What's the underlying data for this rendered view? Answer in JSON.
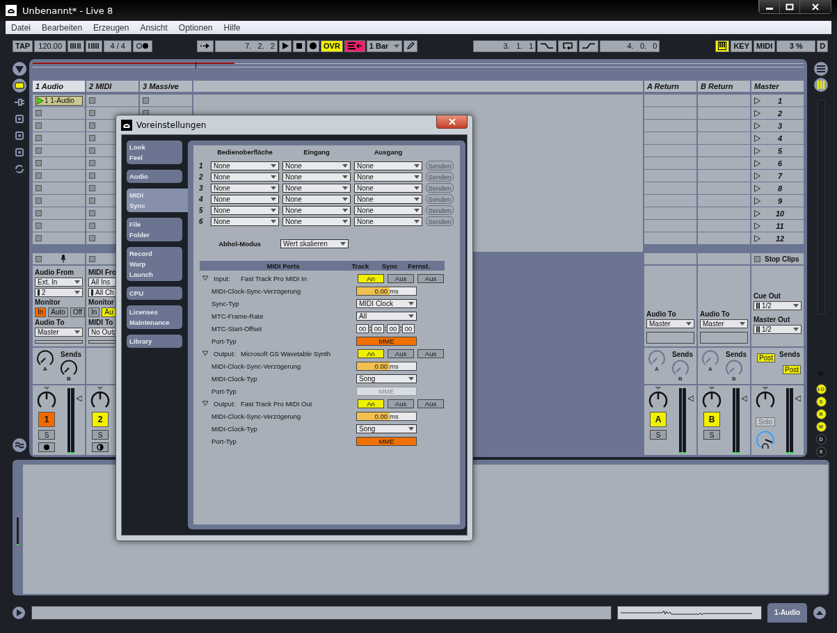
{
  "window": {
    "title": "Unbenannt* - Live 8"
  },
  "menu": [
    "Datei",
    "Bearbeiten",
    "Erzeugen",
    "Ansicht",
    "Optionen",
    "Hilfe"
  ],
  "transport": {
    "tap": "TAP",
    "tempo": "120.00",
    "signature": "4 / 4",
    "position": "7.   2.   2",
    "overdub": {
      "label": "OVR",
      "on": true
    },
    "automation_on": true,
    "quantize": "1 Bar",
    "loop_start": "3.   1.   1",
    "loop_length": "4.   0.   0",
    "key_map_on": true,
    "key": "KEY",
    "midi": "MIDI",
    "cpu": "3 %",
    "disk": "D"
  },
  "tracks": [
    {
      "name": "1 Audio",
      "kind": "audio",
      "selected": true,
      "slots": [
        {
          "has_clip": true,
          "name": "1 1-Audio",
          "playing": true
        },
        {
          "has_clip": false
        },
        {
          "has_clip": false
        },
        {
          "has_clip": false
        },
        {
          "has_clip": false
        },
        {
          "has_clip": false
        },
        {
          "has_clip": false
        },
        {
          "has_clip": false
        },
        {
          "has_clip": false
        },
        {
          "has_clip": false
        },
        {
          "has_clip": false
        },
        {
          "has_clip": false
        }
      ],
      "io": {
        "input_label": "Audio From",
        "input_type": "Ext. In",
        "input_channel": "2",
        "monitor_label": "Monitor",
        "monitor": [
          {
            "label": "In",
            "selected": true
          },
          {
            "label": "Auto",
            "selected": false
          },
          {
            "label": "Off",
            "selected": false
          }
        ],
        "output_label": "Audio To",
        "output": "Master"
      },
      "sends": {
        "label": "Sends",
        "knobs": [
          "A",
          "B"
        ]
      },
      "mixer": {
        "number": "1",
        "color": "#f06a00",
        "solo": "S"
      }
    },
    {
      "name": "2 MIDI",
      "kind": "midi",
      "selected": false,
      "slots": [
        {
          "has_clip": false
        },
        {
          "has_clip": false
        },
        {
          "has_clip": false
        },
        {
          "has_clip": false
        },
        {
          "has_clip": false
        },
        {
          "has_clip": false
        },
        {
          "has_clip": false
        },
        {
          "has_clip": false
        },
        {
          "has_clip": false
        },
        {
          "has_clip": false
        },
        {
          "has_clip": false
        },
        {
          "has_clip": false
        }
      ],
      "io": {
        "input_label": "MIDI Fro",
        "input_type": "All Ins",
        "input_channel": "All Ch",
        "monitor_label": "Monitor",
        "monitor": [
          {
            "label": "In",
            "selected": false
          },
          {
            "label": "Au",
            "selected": true
          }
        ],
        "output_label": "MIDI To",
        "output": "No Outp"
      },
      "mixer": {
        "number": "2",
        "color": "#f0f000",
        "solo": "S"
      }
    },
    {
      "name": "3 Massive",
      "selected": false,
      "slots": [
        {
          "has_clip": false
        },
        {
          "has_clip": false
        }
      ]
    }
  ],
  "returns": [
    {
      "name": "A Return",
      "io": {
        "output_label": "Audio To",
        "output": "Master"
      },
      "sends": {
        "label": "Sends",
        "knobs": [
          "A",
          "B"
        ]
      },
      "mixer": {
        "number": "A",
        "color": "#f0f000",
        "solo": "S"
      }
    },
    {
      "name": "B Return",
      "io": {
        "output_label": "Audio To",
        "output": "Master"
      },
      "sends": {
        "label": "Sends",
        "knobs": [
          "A",
          "B"
        ]
      },
      "mixer": {
        "number": "B",
        "color": "#f0f000",
        "solo": "S"
      }
    }
  ],
  "master": {
    "name": "Master",
    "scenes": [
      "1",
      "2",
      "3",
      "4",
      "5",
      "6",
      "7",
      "8",
      "9",
      "10",
      "11",
      "12"
    ],
    "stop_clips": "Stop Clips",
    "cue_out_label": "Cue Out",
    "cue_out": "1/2",
    "master_out_label": "Master Out",
    "master_out": "1/2",
    "sends_label": "Sends",
    "post": [
      "Post",
      "Post"
    ],
    "solo": "Solo"
  },
  "view_buttons": [
    {
      "label": "I-O",
      "on": true
    },
    {
      "label": "S",
      "on": true
    },
    {
      "label": "R",
      "on": true
    },
    {
      "label": "M",
      "on": true
    },
    {
      "label": "D",
      "on": false
    },
    {
      "label": "X",
      "on": false
    }
  ],
  "status_bar": {
    "track": "1-Audio"
  },
  "preferences": {
    "title": "Voreinstellungen",
    "tabs": [
      {
        "lines": [
          "Look",
          "Feel"
        ],
        "selected": false
      },
      {
        "lines": [
          "Audio"
        ],
        "selected": false
      },
      {
        "lines": [
          "MIDI",
          "Sync"
        ],
        "selected": true
      },
      {
        "lines": [
          "File",
          "Folder"
        ],
        "selected": false
      },
      {
        "lines": [
          "Record",
          "Warp",
          "Launch"
        ],
        "selected": false
      },
      {
        "lines": [
          "CPU"
        ],
        "selected": false
      },
      {
        "lines": [
          "Licenses",
          "Maintenance"
        ],
        "selected": false
      },
      {
        "lines": [
          "Library"
        ],
        "selected": false
      }
    ],
    "control_surfaces": {
      "columns": [
        "Bedienoberfläche",
        "Eingang",
        "Ausgang"
      ],
      "rows": [
        {
          "number": "1",
          "surface": "None",
          "input": "None",
          "output": "None",
          "send": "Senden",
          "disabled": true
        },
        {
          "number": "2",
          "surface": "None",
          "input": "None",
          "output": "None",
          "send": "Senden",
          "disabled": true
        },
        {
          "number": "3",
          "surface": "None",
          "input": "None",
          "output": "None",
          "send": "Senden",
          "disabled": true
        },
        {
          "number": "4",
          "surface": "None",
          "input": "None",
          "output": "None",
          "send": "Senden",
          "disabled": true
        },
        {
          "number": "5",
          "surface": "None",
          "input": "None",
          "output": "None",
          "send": "Senden",
          "disabled": true
        },
        {
          "number": "6",
          "surface": "None",
          "input": "None",
          "output": "None",
          "send": "Senden",
          "disabled": true
        }
      ]
    },
    "takeover": {
      "label": "Abhol-Modus",
      "value": "Wert skalieren"
    },
    "ports": {
      "columns": [
        "MIDI Ports",
        "Track",
        "Sync",
        "Fernst."
      ],
      "items": [
        {
          "direction": "Input:",
          "name": "Fast Track Pro MIDI In",
          "expanded": true,
          "switches": [
            {
              "label": "An",
              "on": true
            },
            {
              "label": "Aus",
              "on": false
            },
            {
              "label": "Aus",
              "on": false
            }
          ],
          "settings": [
            {
              "kind": "delay",
              "label": "MIDI-Clock-Sync-Verzögerung",
              "value": "0.00",
              "unit": "ms",
              "level": 0.55
            },
            {
              "kind": "choice",
              "label": "Sync-Typ",
              "value": "MIDI Clock"
            },
            {
              "kind": "choice",
              "label": "MTC-Frame-Rate",
              "value": "All"
            },
            {
              "kind": "timecode",
              "label": "MTC-Start-Offset",
              "fields": [
                "00",
                "00",
                "00",
                "00"
              ]
            },
            {
              "kind": "porttype",
              "label": "Port-Typ",
              "value": "MME",
              "on": true
            }
          ]
        },
        {
          "direction": "Output:",
          "name": "Microsoft GS Wavetable Synth",
          "expanded": true,
          "switches": [
            {
              "label": "An",
              "on": true
            },
            {
              "label": "Aus",
              "on": false
            },
            {
              "label": "Aus",
              "on": false
            }
          ],
          "settings": [
            {
              "kind": "delay",
              "label": "MIDI-Clock-Sync-Verzögerung",
              "value": "0.00",
              "unit": "ms",
              "level": 0.55
            },
            {
              "kind": "choice",
              "label": "MIDI-Clock-Typ",
              "value": "Song"
            },
            {
              "kind": "porttype",
              "label": "Port-Typ",
              "value": "MME",
              "on": false
            }
          ]
        },
        {
          "direction": "Output:",
          "name": "Fast Track Pro MIDI Out",
          "expanded": true,
          "switches": [
            {
              "label": "An",
              "on": true
            },
            {
              "label": "Aus",
              "on": false
            },
            {
              "label": "Aus",
              "on": false
            }
          ],
          "settings": [
            {
              "kind": "delay",
              "label": "MIDI-Clock-Sync-Verzögerung",
              "value": "0.00",
              "unit": "ms",
              "level": 0.55
            },
            {
              "kind": "choice",
              "label": "MIDI-Clock-Typ",
              "value": "Song"
            },
            {
              "kind": "porttype",
              "label": "Port-Typ",
              "value": "MME",
              "on": true
            }
          ]
        }
      ]
    }
  }
}
